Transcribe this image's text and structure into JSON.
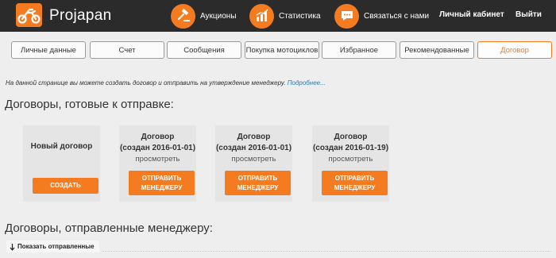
{
  "brand": {
    "name": "Projapan",
    "logo_icon": "motorcycle-icon",
    "accent": "#f47b20"
  },
  "nav": {
    "auctions": {
      "label": "Аукционы",
      "icon": "gavel-icon"
    },
    "stats": {
      "label": "Статистика",
      "icon": "bar-chart-icon"
    },
    "contact": {
      "label": "Связаться с нами",
      "icon": "chat-icon"
    },
    "cabinet": "Личный кабинет",
    "logout": "Выйти"
  },
  "tabs": [
    {
      "label": "Личные данные"
    },
    {
      "label": "Счет"
    },
    {
      "label": "Сообщения"
    },
    {
      "label": "Покупка мотоциклов"
    },
    {
      "label": "Избранное"
    },
    {
      "label": "Рекомендованные"
    },
    {
      "label": "Договор",
      "active": true
    }
  ],
  "intro": {
    "text": "На данной странице вы можете создать договор и отправить на утверждение менеджеру.",
    "more": "Подробнее..."
  },
  "ready_section": {
    "title": "Договоры, готовые к отправке:"
  },
  "new_card": {
    "title": "Новый договор",
    "button": "СОЗДАТЬ"
  },
  "contracts": [
    {
      "title": "Договор",
      "created": "(создан 2016-01-01)",
      "view": "просмотреть",
      "button_line1": "ОТПРАВИТЬ",
      "button_line2": "МЕНЕДЖЕРУ"
    },
    {
      "title": "Договор",
      "created": "(создан 2016-01-01)",
      "view": "просмотреть",
      "button_line1": "ОТПРАВИТЬ",
      "button_line2": "МЕНЕДЖЕРУ"
    },
    {
      "title": "Договор",
      "created": "(создан 2016-01-19)",
      "view": "просмотреть",
      "button_line1": "ОТПРАВИТЬ",
      "button_line2": "МЕНЕДЖЕРУ"
    }
  ],
  "sent_section": {
    "title": "Договоры, отправленные менеджеру:",
    "toggle": "Показать отправленные",
    "toggle_icon": "arrow-down-icon"
  }
}
